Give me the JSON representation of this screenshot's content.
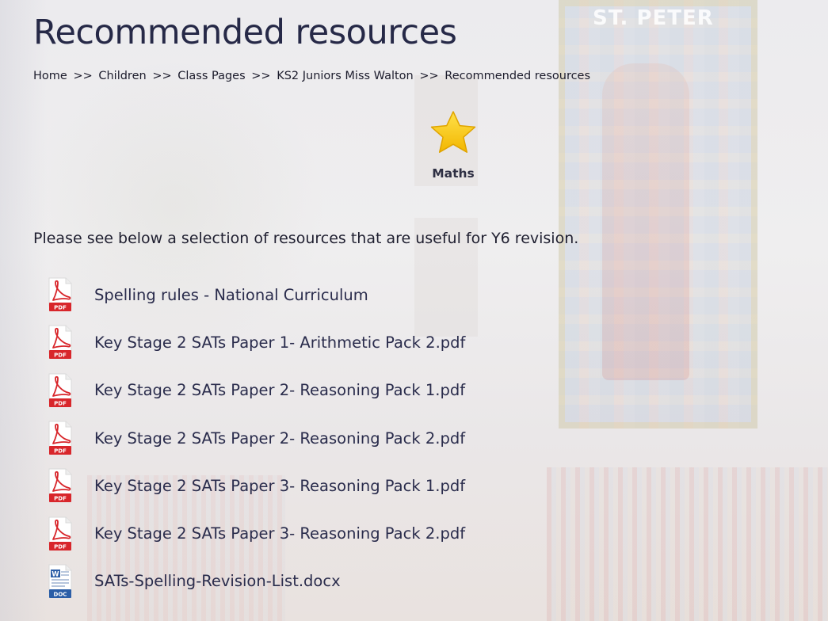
{
  "page": {
    "title": "Recommended resources",
    "breadcrumb": [
      "Home",
      "Children",
      "Class Pages",
      "KS2 Juniors Miss Walton",
      "Recommended resources"
    ],
    "breadcrumb_separator": ">>"
  },
  "background": {
    "window_text": "ST. PETER"
  },
  "subject": {
    "icon": "star-icon",
    "label": "Maths"
  },
  "intro": "Please see below a selection of resources that are useful for Y6 revision.",
  "resources": [
    {
      "label": "Spelling rules - National Curriculum",
      "icon": "pdf-icon",
      "icon_text": "PDF"
    },
    {
      "label": "Key Stage 2 SATs Paper 1- Arithmetic Pack 2.pdf",
      "icon": "pdf-icon",
      "icon_text": "PDF"
    },
    {
      "label": "Key Stage 2 SATs Paper 2- Reasoning Pack 1.pdf",
      "icon": "pdf-icon",
      "icon_text": "PDF"
    },
    {
      "label": "Key Stage 2 SATs Paper 2- Reasoning Pack 2.pdf",
      "icon": "pdf-icon",
      "icon_text": "PDF"
    },
    {
      "label": "Key Stage 2 SATs Paper 3- Reasoning Pack 1.pdf",
      "icon": "pdf-icon",
      "icon_text": "PDF"
    },
    {
      "label": "Key Stage 2 SATs Paper 3- Reasoning Pack 2.pdf",
      "icon": "pdf-icon",
      "icon_text": "PDF"
    },
    {
      "label": "SATs-Spelling-Revision-List.docx",
      "icon": "doc-icon",
      "icon_text": "DOC"
    }
  ],
  "colors": {
    "title": "#262947",
    "pdf_red": "#d8262b",
    "doc_blue": "#2b5ea7",
    "star_yellow": "#f6c400"
  }
}
